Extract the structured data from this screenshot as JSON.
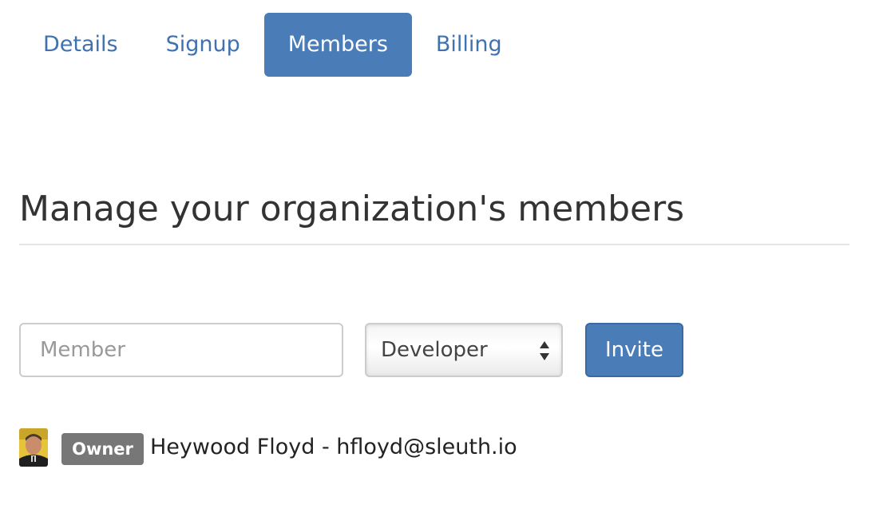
{
  "tabs": [
    {
      "label": "Details",
      "active": false
    },
    {
      "label": "Signup",
      "active": false
    },
    {
      "label": "Members",
      "active": true
    },
    {
      "label": "Billing",
      "active": false
    }
  ],
  "header": {
    "title": "Manage your organization's members"
  },
  "invite_form": {
    "member_placeholder": "Member",
    "member_value": "",
    "role_selected": "Developer",
    "invite_label": "Invite"
  },
  "members": [
    {
      "role": "Owner",
      "name_email": "Heywood Floyd - hfloyd@sleuth.io",
      "avatar_icon": "user-photo-avatar"
    }
  ],
  "colors": {
    "accent": "#4a7db8",
    "tab_text": "#3f72af",
    "badge": "#777777"
  },
  "icons": {
    "select_arrows": "select-updown-arrows-icon"
  }
}
